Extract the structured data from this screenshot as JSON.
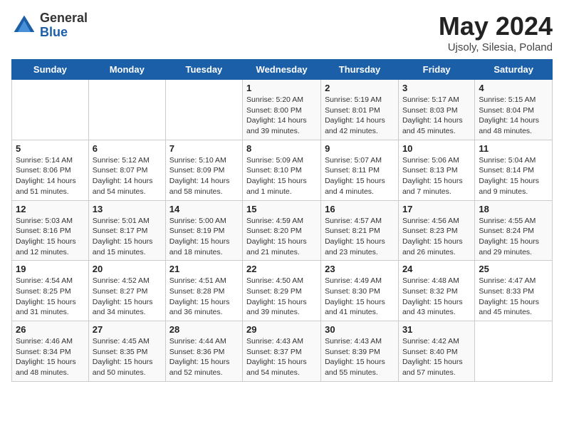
{
  "header": {
    "logo_general": "General",
    "logo_blue": "Blue",
    "title": "May 2024",
    "subtitle": "Ujsoly, Silesia, Poland"
  },
  "days_of_week": [
    "Sunday",
    "Monday",
    "Tuesday",
    "Wednesday",
    "Thursday",
    "Friday",
    "Saturday"
  ],
  "weeks": [
    [
      {
        "day": "",
        "info": ""
      },
      {
        "day": "",
        "info": ""
      },
      {
        "day": "",
        "info": ""
      },
      {
        "day": "1",
        "info": "Sunrise: 5:20 AM\nSunset: 8:00 PM\nDaylight: 14 hours and 39 minutes."
      },
      {
        "day": "2",
        "info": "Sunrise: 5:19 AM\nSunset: 8:01 PM\nDaylight: 14 hours and 42 minutes."
      },
      {
        "day": "3",
        "info": "Sunrise: 5:17 AM\nSunset: 8:03 PM\nDaylight: 14 hours and 45 minutes."
      },
      {
        "day": "4",
        "info": "Sunrise: 5:15 AM\nSunset: 8:04 PM\nDaylight: 14 hours and 48 minutes."
      }
    ],
    [
      {
        "day": "5",
        "info": "Sunrise: 5:14 AM\nSunset: 8:06 PM\nDaylight: 14 hours and 51 minutes."
      },
      {
        "day": "6",
        "info": "Sunrise: 5:12 AM\nSunset: 8:07 PM\nDaylight: 14 hours and 54 minutes."
      },
      {
        "day": "7",
        "info": "Sunrise: 5:10 AM\nSunset: 8:09 PM\nDaylight: 14 hours and 58 minutes."
      },
      {
        "day": "8",
        "info": "Sunrise: 5:09 AM\nSunset: 8:10 PM\nDaylight: 15 hours and 1 minute."
      },
      {
        "day": "9",
        "info": "Sunrise: 5:07 AM\nSunset: 8:11 PM\nDaylight: 15 hours and 4 minutes."
      },
      {
        "day": "10",
        "info": "Sunrise: 5:06 AM\nSunset: 8:13 PM\nDaylight: 15 hours and 7 minutes."
      },
      {
        "day": "11",
        "info": "Sunrise: 5:04 AM\nSunset: 8:14 PM\nDaylight: 15 hours and 9 minutes."
      }
    ],
    [
      {
        "day": "12",
        "info": "Sunrise: 5:03 AM\nSunset: 8:16 PM\nDaylight: 15 hours and 12 minutes."
      },
      {
        "day": "13",
        "info": "Sunrise: 5:01 AM\nSunset: 8:17 PM\nDaylight: 15 hours and 15 minutes."
      },
      {
        "day": "14",
        "info": "Sunrise: 5:00 AM\nSunset: 8:19 PM\nDaylight: 15 hours and 18 minutes."
      },
      {
        "day": "15",
        "info": "Sunrise: 4:59 AM\nSunset: 8:20 PM\nDaylight: 15 hours and 21 minutes."
      },
      {
        "day": "16",
        "info": "Sunrise: 4:57 AM\nSunset: 8:21 PM\nDaylight: 15 hours and 23 minutes."
      },
      {
        "day": "17",
        "info": "Sunrise: 4:56 AM\nSunset: 8:23 PM\nDaylight: 15 hours and 26 minutes."
      },
      {
        "day": "18",
        "info": "Sunrise: 4:55 AM\nSunset: 8:24 PM\nDaylight: 15 hours and 29 minutes."
      }
    ],
    [
      {
        "day": "19",
        "info": "Sunrise: 4:54 AM\nSunset: 8:25 PM\nDaylight: 15 hours and 31 minutes."
      },
      {
        "day": "20",
        "info": "Sunrise: 4:52 AM\nSunset: 8:27 PM\nDaylight: 15 hours and 34 minutes."
      },
      {
        "day": "21",
        "info": "Sunrise: 4:51 AM\nSunset: 8:28 PM\nDaylight: 15 hours and 36 minutes."
      },
      {
        "day": "22",
        "info": "Sunrise: 4:50 AM\nSunset: 8:29 PM\nDaylight: 15 hours and 39 minutes."
      },
      {
        "day": "23",
        "info": "Sunrise: 4:49 AM\nSunset: 8:30 PM\nDaylight: 15 hours and 41 minutes."
      },
      {
        "day": "24",
        "info": "Sunrise: 4:48 AM\nSunset: 8:32 PM\nDaylight: 15 hours and 43 minutes."
      },
      {
        "day": "25",
        "info": "Sunrise: 4:47 AM\nSunset: 8:33 PM\nDaylight: 15 hours and 45 minutes."
      }
    ],
    [
      {
        "day": "26",
        "info": "Sunrise: 4:46 AM\nSunset: 8:34 PM\nDaylight: 15 hours and 48 minutes."
      },
      {
        "day": "27",
        "info": "Sunrise: 4:45 AM\nSunset: 8:35 PM\nDaylight: 15 hours and 50 minutes."
      },
      {
        "day": "28",
        "info": "Sunrise: 4:44 AM\nSunset: 8:36 PM\nDaylight: 15 hours and 52 minutes."
      },
      {
        "day": "29",
        "info": "Sunrise: 4:43 AM\nSunset: 8:37 PM\nDaylight: 15 hours and 54 minutes."
      },
      {
        "day": "30",
        "info": "Sunrise: 4:43 AM\nSunset: 8:39 PM\nDaylight: 15 hours and 55 minutes."
      },
      {
        "day": "31",
        "info": "Sunrise: 4:42 AM\nSunset: 8:40 PM\nDaylight: 15 hours and 57 minutes."
      },
      {
        "day": "",
        "info": ""
      }
    ]
  ]
}
